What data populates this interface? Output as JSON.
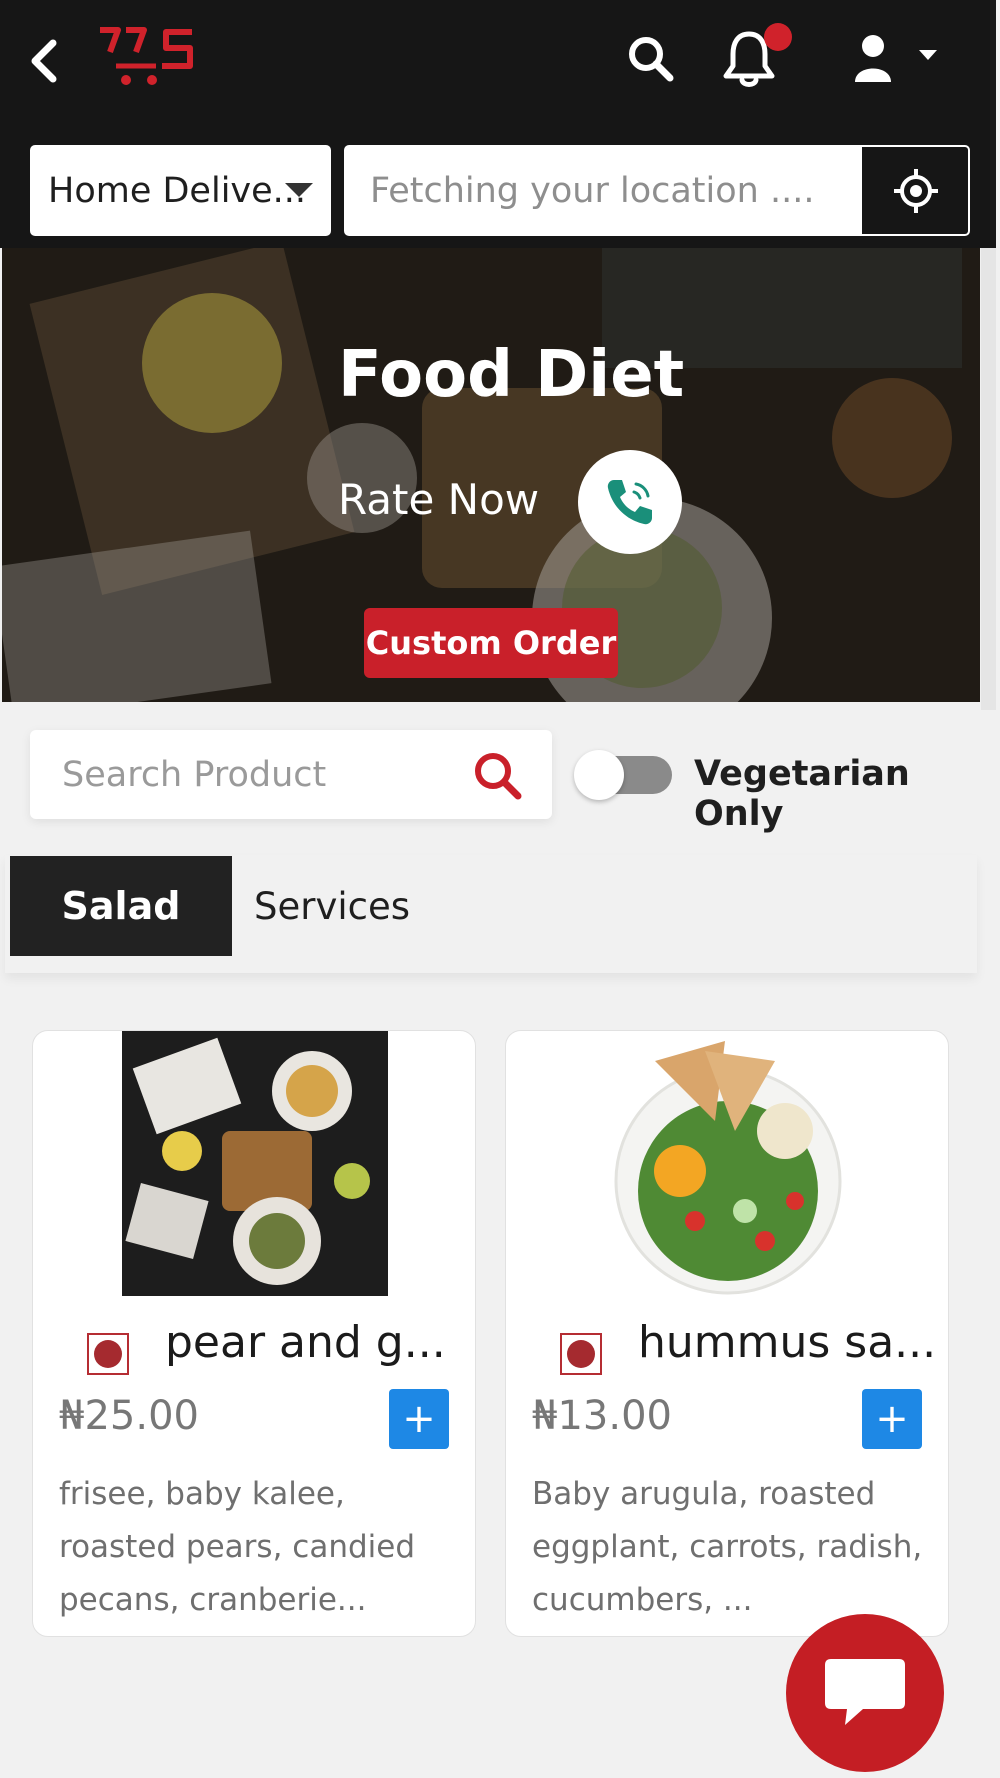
{
  "header": {
    "back_icon": "chevron-left-icon",
    "logo_icon": "cart-logo-icon",
    "search_icon": "search-icon",
    "notification_icon": "bell-icon",
    "user_icon": "user-icon"
  },
  "delivery": {
    "selected": "Home Delive..."
  },
  "location": {
    "placeholder": "Fetching your location ....",
    "icon": "crosshair-icon"
  },
  "hero": {
    "title": "Food Diet",
    "rate_label": "Rate Now",
    "call_icon": "phone-icon",
    "custom_order_label": "Custom Order"
  },
  "product_search": {
    "placeholder": "Search Product",
    "icon": "search-icon"
  },
  "filter": {
    "label": "Vegetarian Only",
    "enabled": false
  },
  "tabs": [
    {
      "label": "Salad",
      "active": true
    },
    {
      "label": "Services",
      "active": false
    }
  ],
  "products": [
    {
      "name": "pear and g...",
      "price": "₦25.00",
      "description": "frisee, baby kalee, roasted pears, candied pecans, cranberie...",
      "add_label": "+"
    },
    {
      "name": "hummus sa...",
      "price": "₦13.00",
      "description": "Baby arugula, roasted eggplant, carrots, radish, cucumbers, ...",
      "add_label": "+"
    }
  ],
  "colors": {
    "header_bg": "#161616",
    "brand_red": "#c9202a",
    "add_blue": "#1e88e5",
    "page_bg": "#f1f1f1"
  }
}
